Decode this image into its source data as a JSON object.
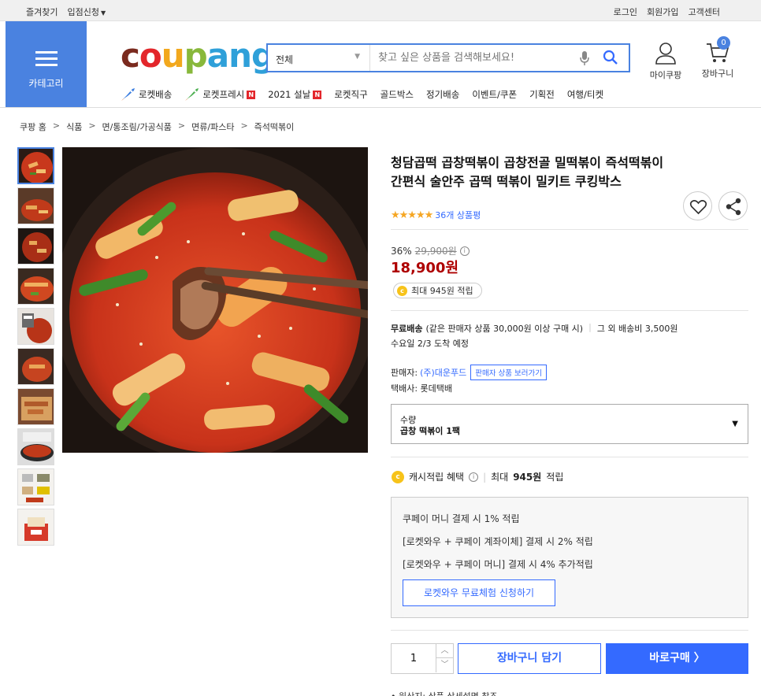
{
  "topbar": {
    "favorites": "즐겨찾기",
    "seller_signup": "입점신청",
    "login": "로그인",
    "join": "회원가입",
    "support": "고객센터"
  },
  "header": {
    "category_label": "카테고리",
    "logo_parts": [
      "c",
      "o",
      "u",
      "p",
      "ang"
    ],
    "search_scope": "전체",
    "search_placeholder": "찾고 싶은 상품을 검색해보세요!",
    "mycoupang": "마이쿠팡",
    "cart": "장바구니",
    "cart_count": "0"
  },
  "nav": {
    "items": [
      {
        "label": "로켓배송",
        "icon": "rocket-blue-icon"
      },
      {
        "label": "로켓프레시",
        "icon": "rocket-green-icon",
        "badge": "N"
      },
      {
        "label": "2021 설날",
        "badge": "N"
      },
      {
        "label": "로켓직구"
      },
      {
        "label": "골드박스"
      },
      {
        "label": "정기배송"
      },
      {
        "label": "이벤트/쿠폰"
      },
      {
        "label": "기획전"
      },
      {
        "label": "여행/티켓"
      }
    ]
  },
  "breadcrumb": [
    "쿠팡 홈",
    "식품",
    "면/통조림/가공식품",
    "면류/파스타",
    "즉석떡볶이"
  ],
  "breadcrumb_sep": ">",
  "product": {
    "title": "청담곱떡 곱창떡볶이 곱창전골 밀떡볶이 즉석떡볶이 간편식 술안주 곱떡 떡볶이 밀키트 쿠킹박스",
    "stars": "★★★★★",
    "review_count": "36개 상품평",
    "discount_rate": "36%",
    "original_price": "29,900원",
    "sale_price": "18,900원",
    "point_text": "최대 945원 적립",
    "coin_symbol": "c",
    "info_symbol": "i",
    "free_ship_label": "무료배송",
    "free_ship_cond": "(같은 판매자 상품 30,000원 이상 구매 시)",
    "ship_bar": "|",
    "other_ship": "그 외 배송비 3,500원",
    "arrival": "수요일 2/3 도착 예정",
    "seller_label": "판매자:",
    "seller_name": "(주)대운푸드",
    "seller_button": "판매자 상품 보러가기",
    "courier": "택배사: 롯데택배",
    "option_label": "수량",
    "option_value": "곱창 떡볶이 1팩"
  },
  "cashback": {
    "label": "캐시적립 혜택",
    "amount_prefix": "최대",
    "amount": "945원",
    "amount_suffix": "적립",
    "benefits": [
      "쿠페이 머니 결제 시 1% 적립",
      "[로켓와우 + 쿠페이 계좌이체] 결제 시 2% 적립",
      "[로켓와우 + 쿠페이 머니] 결제 시 4% 추가적립"
    ],
    "trial_button": "로켓와우 무료체험 신청하기"
  },
  "purchase": {
    "quantity": "1",
    "add_to_cart": "장바구니 담기",
    "buy_now": "바로구매 〉",
    "footer_note": "• 원산지: 상품 상세설명 참조"
  },
  "colors": {
    "accent": "#346aff",
    "category_blue": "#4a82e0",
    "price_red": "#ae0000"
  }
}
